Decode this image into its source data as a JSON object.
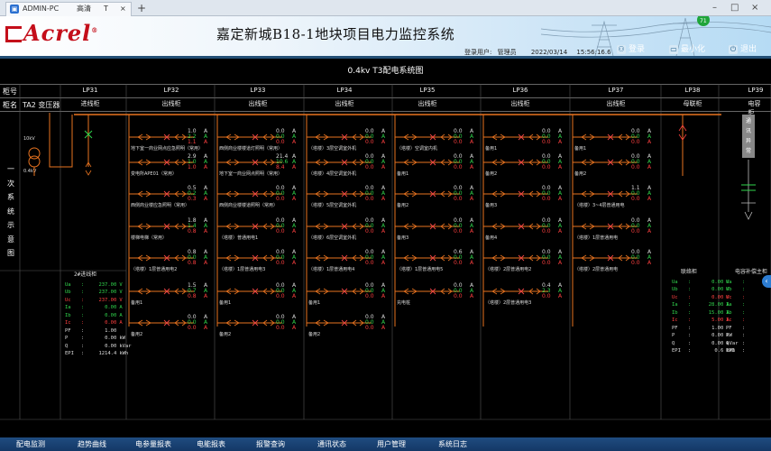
{
  "browser": {
    "tab_host": "ADMIN-PC",
    "tab_mode": "高清",
    "tab_extra": "T",
    "close_glyph": "×",
    "new_tab_glyph": "+",
    "min_glyph": "–",
    "max_glyph": "□",
    "win_close_glyph": "×"
  },
  "header": {
    "brand": "Acrel",
    "title": "嘉定新城B18-1地块项目电力监控系统",
    "user_label": "登录用户:",
    "user_name": "管理员",
    "date": "2022/03/14",
    "time": "15:56:16.6",
    "btn_login": "登录",
    "btn_min": "最小化",
    "btn_exit": "退出",
    "colors": {
      "brand": "#c40e1a",
      "title": "#111111"
    }
  },
  "diagram": {
    "title": "0.4kv T3配电系统图",
    "row1_label": "柜号",
    "row2_label": "柜名",
    "transformer_name": "TA2 变压器",
    "vertical_label": [
      "一",
      "次",
      "系",
      "统",
      "示",
      "意",
      "图"
    ],
    "hv_label": "10kV",
    "lv_label": "0.4kV",
    "cabinets": [
      {
        "no": "LP31",
        "name": "进线柜"
      },
      {
        "no": "LP32",
        "name": "出线柜"
      },
      {
        "no": "LP33",
        "name": "出线柜"
      },
      {
        "no": "LP34",
        "name": "出线柜"
      },
      {
        "no": "LP35",
        "name": "出线柜"
      },
      {
        "no": "LP36",
        "name": "出线柜"
      },
      {
        "no": "LP37",
        "name": "出线柜"
      },
      {
        "no": "LP38",
        "name": "母联柜"
      },
      {
        "no": "LP39",
        "name": "电容柜"
      }
    ],
    "columns": [
      {
        "feeders": [
          {
            "v1": "1.0",
            "v2": "2.2",
            "v3": "1.1",
            "label": "地下室一商业网点应急照明（常用）"
          },
          {
            "v1": "2.9",
            "v2": "1.0",
            "v3": "1.0",
            "label": "变电所APE01（常用）"
          },
          {
            "v1": "0.5",
            "v2": "0.2",
            "v3": "0.3",
            "label": "西侧商业楼应急照明（常用）"
          },
          {
            "v1": "1.8",
            "v2": "1.4",
            "v3": "0.8",
            "label": "楼梯电梯（常用）"
          },
          {
            "v1": "0.8",
            "v2": "0.0",
            "v3": "0.8",
            "label": "（塔楼）1层普通用电2"
          },
          {
            "v1": "1.5",
            "v2": "0.7",
            "v3": "0.8",
            "label": "备用1"
          },
          {
            "v1": "0.0",
            "v2": "0.0",
            "v3": "0.0",
            "label": "备用2"
          }
        ]
      },
      {
        "feeders": [
          {
            "v1": "0.0",
            "v2": "0.0",
            "v3": "0.0",
            "label": "西侧商业楼楼道灯照明（常用）"
          },
          {
            "v1": "21.4",
            "v2": "10.6",
            "v3": "8.4",
            "label": "地下室一商业网点照明（常用）"
          },
          {
            "v1": "0.0",
            "v2": "0.0",
            "v3": "0.0",
            "label": "西侧商业楼楼道照明（常用）"
          },
          {
            "v1": "0.0",
            "v2": "0.0",
            "v3": "0.0",
            "label": "（塔楼）普通用电1"
          },
          {
            "v1": "0.0",
            "v2": "0.0",
            "v3": "0.0",
            "label": "（塔楼）1层普通用电3"
          },
          {
            "v1": "0.0",
            "v2": "0.0",
            "v3": "0.0",
            "label": "备用1"
          },
          {
            "v1": "0.0",
            "v2": "0.0",
            "v3": "0.0",
            "label": "备用2"
          }
        ]
      },
      {
        "feeders": [
          {
            "v1": "0.0",
            "v2": "0.0",
            "v3": "0.0",
            "label": "（塔楼）3层空调室外机"
          },
          {
            "v1": "0.0",
            "v2": "0.0",
            "v3": "0.0",
            "label": "（塔楼）4层空调室外机"
          },
          {
            "v1": "0.0",
            "v2": "0.0",
            "v3": "0.0",
            "label": "（塔楼）5层空调室外机"
          },
          {
            "v1": "0.0",
            "v2": "0.0",
            "v3": "0.0",
            "label": "（塔楼）6层空调室外机"
          },
          {
            "v1": "0.0",
            "v2": "0.0",
            "v3": "0.0",
            "label": "（塔楼）1层普通用电4"
          },
          {
            "v1": "0.0",
            "v2": "0.0",
            "v3": "0.0",
            "label": "备用1"
          },
          {
            "v1": "0.0",
            "v2": "0.0",
            "v3": "0.0",
            "label": "备用2"
          }
        ]
      },
      {
        "feeders": [
          {
            "v1": "0.0",
            "v2": "0.0",
            "v3": "0.0",
            "label": "（塔楼）空调室内机"
          },
          {
            "v1": "0.0",
            "v2": "0.0",
            "v3": "0.0",
            "label": "备用1"
          },
          {
            "v1": "0.0",
            "v2": "0.0",
            "v3": "0.0",
            "label": "备用2"
          },
          {
            "v1": "0.0",
            "v2": "0.0",
            "v3": "0.0",
            "label": "备用3"
          },
          {
            "v1": "0.6",
            "v2": "0.0",
            "v3": "0.0",
            "label": "（塔楼）1层普通用电5"
          },
          {
            "v1": "0.0",
            "v2": "0.0",
            "v3": "0.0",
            "label": "充电桩"
          },
          {
            "v1": "",
            "v2": "",
            "v3": "",
            "label": ""
          }
        ]
      },
      {
        "feeders": [
          {
            "v1": "0.0",
            "v2": "0.0",
            "v3": "0.0",
            "label": "备用1"
          },
          {
            "v1": "0.0",
            "v2": "0.0",
            "v3": "0.0",
            "label": "备用2"
          },
          {
            "v1": "0.0",
            "v2": "0.0",
            "v3": "0.0",
            "label": "备用3"
          },
          {
            "v1": "0.0",
            "v2": "0.0",
            "v3": "0.0",
            "label": "备用4"
          },
          {
            "v1": "0.0",
            "v2": "0.0",
            "v3": "0.0",
            "label": "（塔楼）2层普通用电2"
          },
          {
            "v1": "0.4",
            "v2": "2.3",
            "v3": "0.0",
            "label": "（塔楼）2层普通用电3"
          },
          {
            "v1": "",
            "v2": "",
            "v3": "",
            "label": ""
          }
        ]
      },
      {
        "feeders": [
          {
            "v1": "0.0",
            "v2": "0.0",
            "v3": "0.0",
            "label": "备用1"
          },
          {
            "v1": "0.0",
            "v2": "0.0",
            "v3": "0.0",
            "label": "备用2"
          },
          {
            "v1": "1.1",
            "v2": "0.0",
            "v3": "0.0",
            "label": "（塔楼）3~4层普通用电"
          },
          {
            "v1": "0.0",
            "v2": "0.0",
            "v3": "0.0",
            "label": "（塔楼）1层普通用电"
          },
          {
            "v1": "0.0",
            "v2": "0.0",
            "v3": "0.0",
            "label": "（塔楼）2层普通用电"
          },
          {
            "v1": "",
            "v2": "",
            "v3": "",
            "label": ""
          },
          {
            "v1": "",
            "v2": "",
            "v3": "",
            "label": ""
          }
        ]
      }
    ],
    "incoming": {
      "title": "2#进线柜",
      "rows": [
        {
          "k": "Ua",
          "v": "237.00",
          "u": "V",
          "c": "g"
        },
        {
          "k": "Ub",
          "v": "237.00",
          "u": "V",
          "c": "g"
        },
        {
          "k": "Uc",
          "v": "237.00",
          "u": "V",
          "c": "r"
        },
        {
          "k": "Ia",
          "v": "0.00",
          "u": "A",
          "c": "g"
        },
        {
          "k": "Ib",
          "v": "0.00",
          "u": "A",
          "c": "g"
        },
        {
          "k": "Ic",
          "v": "0.00",
          "u": "A",
          "c": "r"
        },
        {
          "k": "PF",
          "v": "1.00",
          "u": "",
          "c": "w"
        },
        {
          "k": "P",
          "v": "0.00",
          "u": "kW",
          "c": "w"
        },
        {
          "k": "Q",
          "v": "0.00",
          "u": "kVar",
          "c": "w"
        },
        {
          "k": "EPI",
          "v": "1214.4",
          "u": "kWh",
          "c": "w"
        }
      ]
    },
    "tie": {
      "title": "联络柜",
      "rows": [
        {
          "k": "Ua",
          "v": "0.00",
          "u": "V",
          "c": "g"
        },
        {
          "k": "Ub",
          "v": "0.00",
          "u": "V",
          "c": "g"
        },
        {
          "k": "Uc",
          "v": "0.00",
          "u": "V",
          "c": "r"
        },
        {
          "k": "Ia",
          "v": "28.00",
          "u": "A",
          "c": "g"
        },
        {
          "k": "Ib",
          "v": "15.00",
          "u": "A",
          "c": "g"
        },
        {
          "k": "Ic",
          "v": "5.00",
          "u": "A",
          "c": "r"
        },
        {
          "k": "PF",
          "v": "1.00",
          "u": "",
          "c": "w"
        },
        {
          "k": "P",
          "v": "0.00",
          "u": "kW",
          "c": "w"
        },
        {
          "k": "Q",
          "v": "0.00",
          "u": "kVar",
          "c": "w"
        },
        {
          "k": "EPI",
          "v": "0.6",
          "u": "kWh",
          "c": "w"
        }
      ]
    },
    "capacitor": {
      "title": "电容补偿主柜",
      "box_label": [
        "通",
        "讯",
        "异",
        "常"
      ],
      "rows": [
        {
          "k": "Ua",
          "c": "g"
        },
        {
          "k": "Ub",
          "c": "g"
        },
        {
          "k": "Uc",
          "c": "r"
        },
        {
          "k": "Ia",
          "c": "g"
        },
        {
          "k": "Ib",
          "c": "g"
        },
        {
          "k": "Ic",
          "c": "r"
        },
        {
          "k": "PF",
          "c": "w"
        },
        {
          "k": "P",
          "c": "w"
        },
        {
          "k": "Q",
          "c": "w"
        },
        {
          "k": "EPI",
          "c": "w"
        }
      ]
    },
    "unit_a": "A",
    "colors": {
      "feeder": "#e8731f",
      "bus": "#f07a20",
      "green": "#31d64d",
      "red": "#ff4040"
    }
  },
  "footer": {
    "tabs": [
      "配电监测",
      "趋势曲线",
      "电参量报表",
      "电能报表",
      "报警查询",
      "通讯状态",
      "用户管理",
      "系统日志"
    ]
  }
}
